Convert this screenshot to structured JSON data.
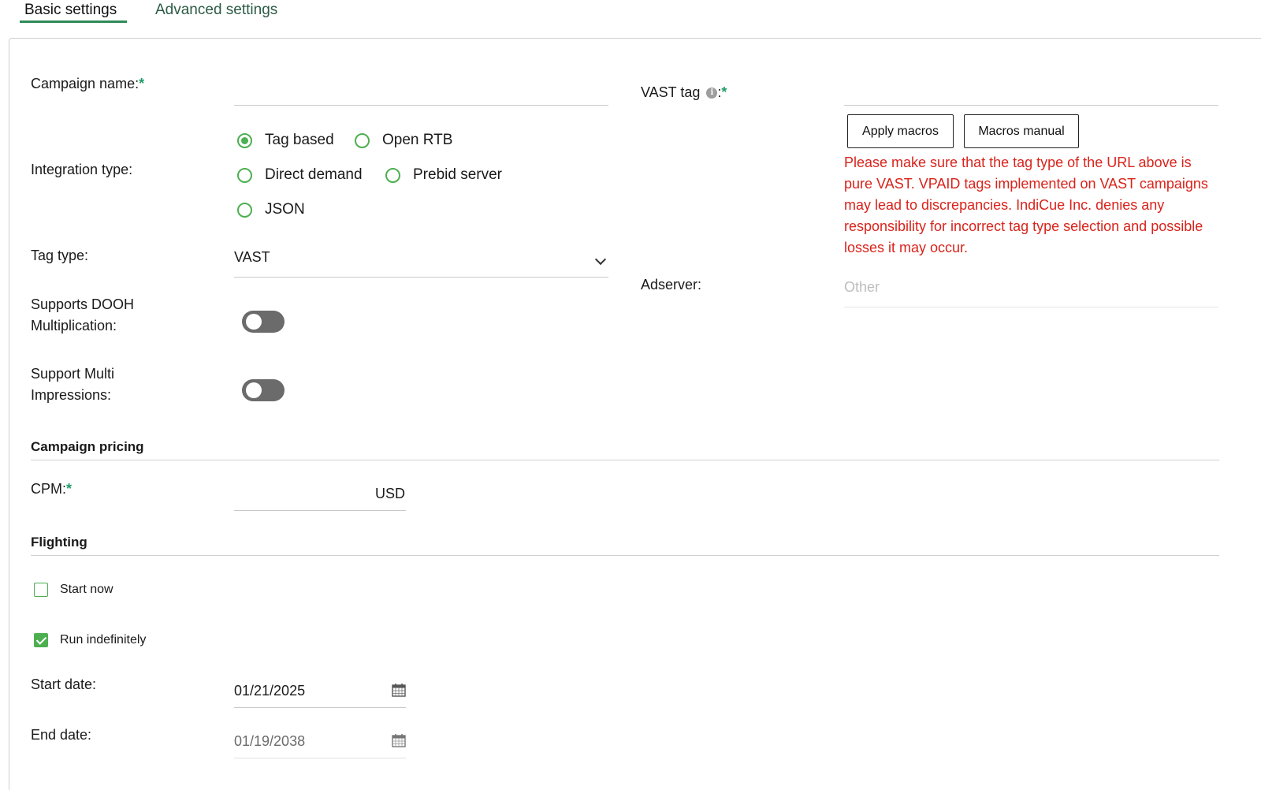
{
  "tabs": {
    "basic": "Basic settings",
    "advanced": "Advanced settings"
  },
  "campaign_name": {
    "label": "Campaign name:",
    "required_mark": "*",
    "value": ""
  },
  "integration_type": {
    "label": "Integration type:",
    "options": [
      "Tag based",
      "Open RTB",
      "Direct demand",
      "Prebid server",
      "JSON"
    ],
    "selected": "Tag based"
  },
  "tag_type": {
    "label": "Tag type:",
    "value": "VAST"
  },
  "dooh": {
    "label_line1": "Supports DOOH",
    "label_line2": "Multiplication:",
    "enabled": false
  },
  "multi_impressions": {
    "label_line1": "Support Multi",
    "label_line2": "Impressions:",
    "enabled": false
  },
  "vast_tag": {
    "label": "VAST tag",
    "info_icon": "info-icon",
    "colon": ":",
    "required_mark": "*",
    "value": "",
    "apply_macros": "Apply macros",
    "macros_manual": "Macros manual",
    "warning": "Please make sure that the tag type of the URL above is pure VAST. VPAID tags implemented on VAST campaigns may lead to discrepancies. IndiCue Inc. denies any responsibility for incorrect tag type selection and possible losses it may occur."
  },
  "adserver": {
    "label": "Adserver:",
    "placeholder": "Other"
  },
  "pricing": {
    "section_title": "Campaign pricing",
    "cpm_label": "CPM:",
    "required_mark": "*",
    "currency": "USD"
  },
  "flighting": {
    "section_title": "Flighting",
    "start_now": {
      "label": "Start now",
      "checked": false
    },
    "run_indefinitely": {
      "label": "Run indefinitely",
      "checked": true
    },
    "start_date": {
      "label": "Start date:",
      "value": "01/21/2025"
    },
    "end_date": {
      "label": "End date:",
      "value": "01/19/2038"
    }
  },
  "colors": {
    "accent_green": "#4caf50",
    "warning_red": "#d9231b",
    "toggle_off": "#6b6b6b"
  }
}
